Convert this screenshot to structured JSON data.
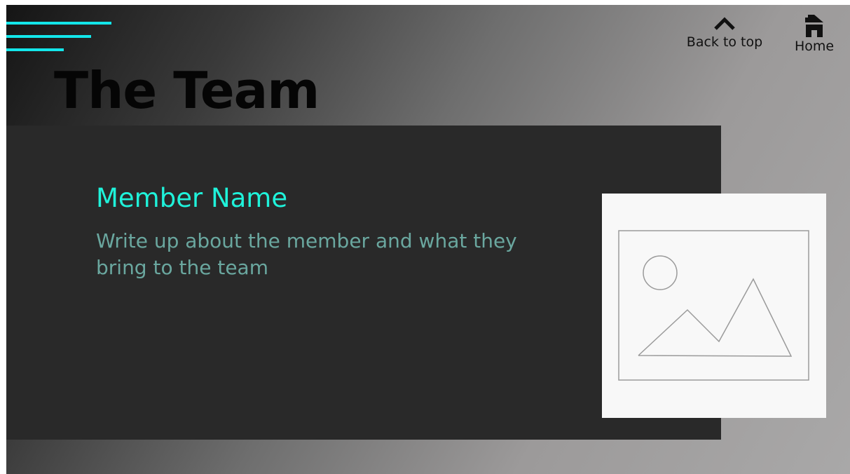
{
  "header": {
    "title": "The Team",
    "menu_icon": "hamburger-menu-icon"
  },
  "nav": {
    "back_to_top": {
      "label": "Back to top",
      "icon": "chevron-up-icon"
    },
    "home": {
      "label": "Home",
      "icon": "home-icon"
    }
  },
  "member": {
    "name": "Member Name",
    "description": "Write up about the member and what they bring to the team",
    "photo_icon": "image-placeholder-icon"
  },
  "colors": {
    "accent": "#13e6ea",
    "name_text": "#1ff2da",
    "description_text": "#6aa79f",
    "card_background": "#292929"
  }
}
